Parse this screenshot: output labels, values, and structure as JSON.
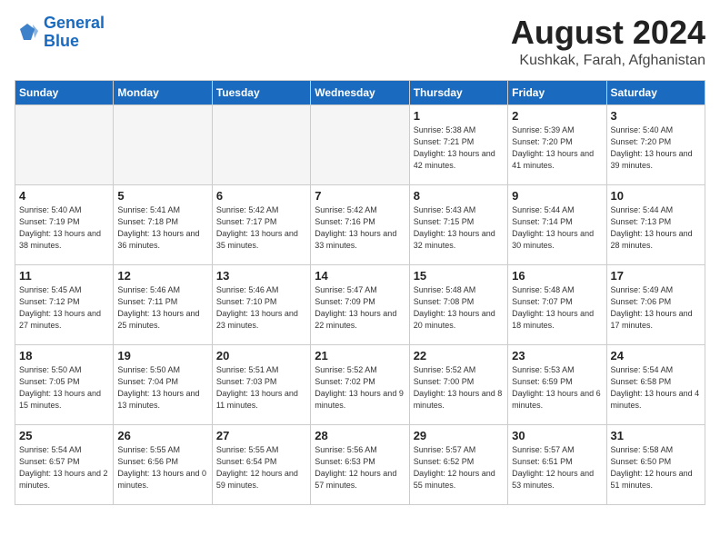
{
  "header": {
    "logo_line1": "General",
    "logo_line2": "Blue",
    "month_year": "August 2024",
    "location": "Kushkak, Farah, Afghanistan"
  },
  "weekdays": [
    "Sunday",
    "Monday",
    "Tuesday",
    "Wednesday",
    "Thursday",
    "Friday",
    "Saturday"
  ],
  "weeks": [
    [
      {
        "day": "",
        "info": ""
      },
      {
        "day": "",
        "info": ""
      },
      {
        "day": "",
        "info": ""
      },
      {
        "day": "",
        "info": ""
      },
      {
        "day": "1",
        "info": "Sunrise: 5:38 AM\nSunset: 7:21 PM\nDaylight: 13 hours\nand 42 minutes."
      },
      {
        "day": "2",
        "info": "Sunrise: 5:39 AM\nSunset: 7:20 PM\nDaylight: 13 hours\nand 41 minutes."
      },
      {
        "day": "3",
        "info": "Sunrise: 5:40 AM\nSunset: 7:20 PM\nDaylight: 13 hours\nand 39 minutes."
      }
    ],
    [
      {
        "day": "4",
        "info": "Sunrise: 5:40 AM\nSunset: 7:19 PM\nDaylight: 13 hours\nand 38 minutes."
      },
      {
        "day": "5",
        "info": "Sunrise: 5:41 AM\nSunset: 7:18 PM\nDaylight: 13 hours\nand 36 minutes."
      },
      {
        "day": "6",
        "info": "Sunrise: 5:42 AM\nSunset: 7:17 PM\nDaylight: 13 hours\nand 35 minutes."
      },
      {
        "day": "7",
        "info": "Sunrise: 5:42 AM\nSunset: 7:16 PM\nDaylight: 13 hours\nand 33 minutes."
      },
      {
        "day": "8",
        "info": "Sunrise: 5:43 AM\nSunset: 7:15 PM\nDaylight: 13 hours\nand 32 minutes."
      },
      {
        "day": "9",
        "info": "Sunrise: 5:44 AM\nSunset: 7:14 PM\nDaylight: 13 hours\nand 30 minutes."
      },
      {
        "day": "10",
        "info": "Sunrise: 5:44 AM\nSunset: 7:13 PM\nDaylight: 13 hours\nand 28 minutes."
      }
    ],
    [
      {
        "day": "11",
        "info": "Sunrise: 5:45 AM\nSunset: 7:12 PM\nDaylight: 13 hours\nand 27 minutes."
      },
      {
        "day": "12",
        "info": "Sunrise: 5:46 AM\nSunset: 7:11 PM\nDaylight: 13 hours\nand 25 minutes."
      },
      {
        "day": "13",
        "info": "Sunrise: 5:46 AM\nSunset: 7:10 PM\nDaylight: 13 hours\nand 23 minutes."
      },
      {
        "day": "14",
        "info": "Sunrise: 5:47 AM\nSunset: 7:09 PM\nDaylight: 13 hours\nand 22 minutes."
      },
      {
        "day": "15",
        "info": "Sunrise: 5:48 AM\nSunset: 7:08 PM\nDaylight: 13 hours\nand 20 minutes."
      },
      {
        "day": "16",
        "info": "Sunrise: 5:48 AM\nSunset: 7:07 PM\nDaylight: 13 hours\nand 18 minutes."
      },
      {
        "day": "17",
        "info": "Sunrise: 5:49 AM\nSunset: 7:06 PM\nDaylight: 13 hours\nand 17 minutes."
      }
    ],
    [
      {
        "day": "18",
        "info": "Sunrise: 5:50 AM\nSunset: 7:05 PM\nDaylight: 13 hours\nand 15 minutes."
      },
      {
        "day": "19",
        "info": "Sunrise: 5:50 AM\nSunset: 7:04 PM\nDaylight: 13 hours\nand 13 minutes."
      },
      {
        "day": "20",
        "info": "Sunrise: 5:51 AM\nSunset: 7:03 PM\nDaylight: 13 hours\nand 11 minutes."
      },
      {
        "day": "21",
        "info": "Sunrise: 5:52 AM\nSunset: 7:02 PM\nDaylight: 13 hours\nand 9 minutes."
      },
      {
        "day": "22",
        "info": "Sunrise: 5:52 AM\nSunset: 7:00 PM\nDaylight: 13 hours\nand 8 minutes."
      },
      {
        "day": "23",
        "info": "Sunrise: 5:53 AM\nSunset: 6:59 PM\nDaylight: 13 hours\nand 6 minutes."
      },
      {
        "day": "24",
        "info": "Sunrise: 5:54 AM\nSunset: 6:58 PM\nDaylight: 13 hours\nand 4 minutes."
      }
    ],
    [
      {
        "day": "25",
        "info": "Sunrise: 5:54 AM\nSunset: 6:57 PM\nDaylight: 13 hours\nand 2 minutes."
      },
      {
        "day": "26",
        "info": "Sunrise: 5:55 AM\nSunset: 6:56 PM\nDaylight: 13 hours\nand 0 minutes."
      },
      {
        "day": "27",
        "info": "Sunrise: 5:55 AM\nSunset: 6:54 PM\nDaylight: 12 hours\nand 59 minutes."
      },
      {
        "day": "28",
        "info": "Sunrise: 5:56 AM\nSunset: 6:53 PM\nDaylight: 12 hours\nand 57 minutes."
      },
      {
        "day": "29",
        "info": "Sunrise: 5:57 AM\nSunset: 6:52 PM\nDaylight: 12 hours\nand 55 minutes."
      },
      {
        "day": "30",
        "info": "Sunrise: 5:57 AM\nSunset: 6:51 PM\nDaylight: 12 hours\nand 53 minutes."
      },
      {
        "day": "31",
        "info": "Sunrise: 5:58 AM\nSunset: 6:50 PM\nDaylight: 12 hours\nand 51 minutes."
      }
    ]
  ]
}
